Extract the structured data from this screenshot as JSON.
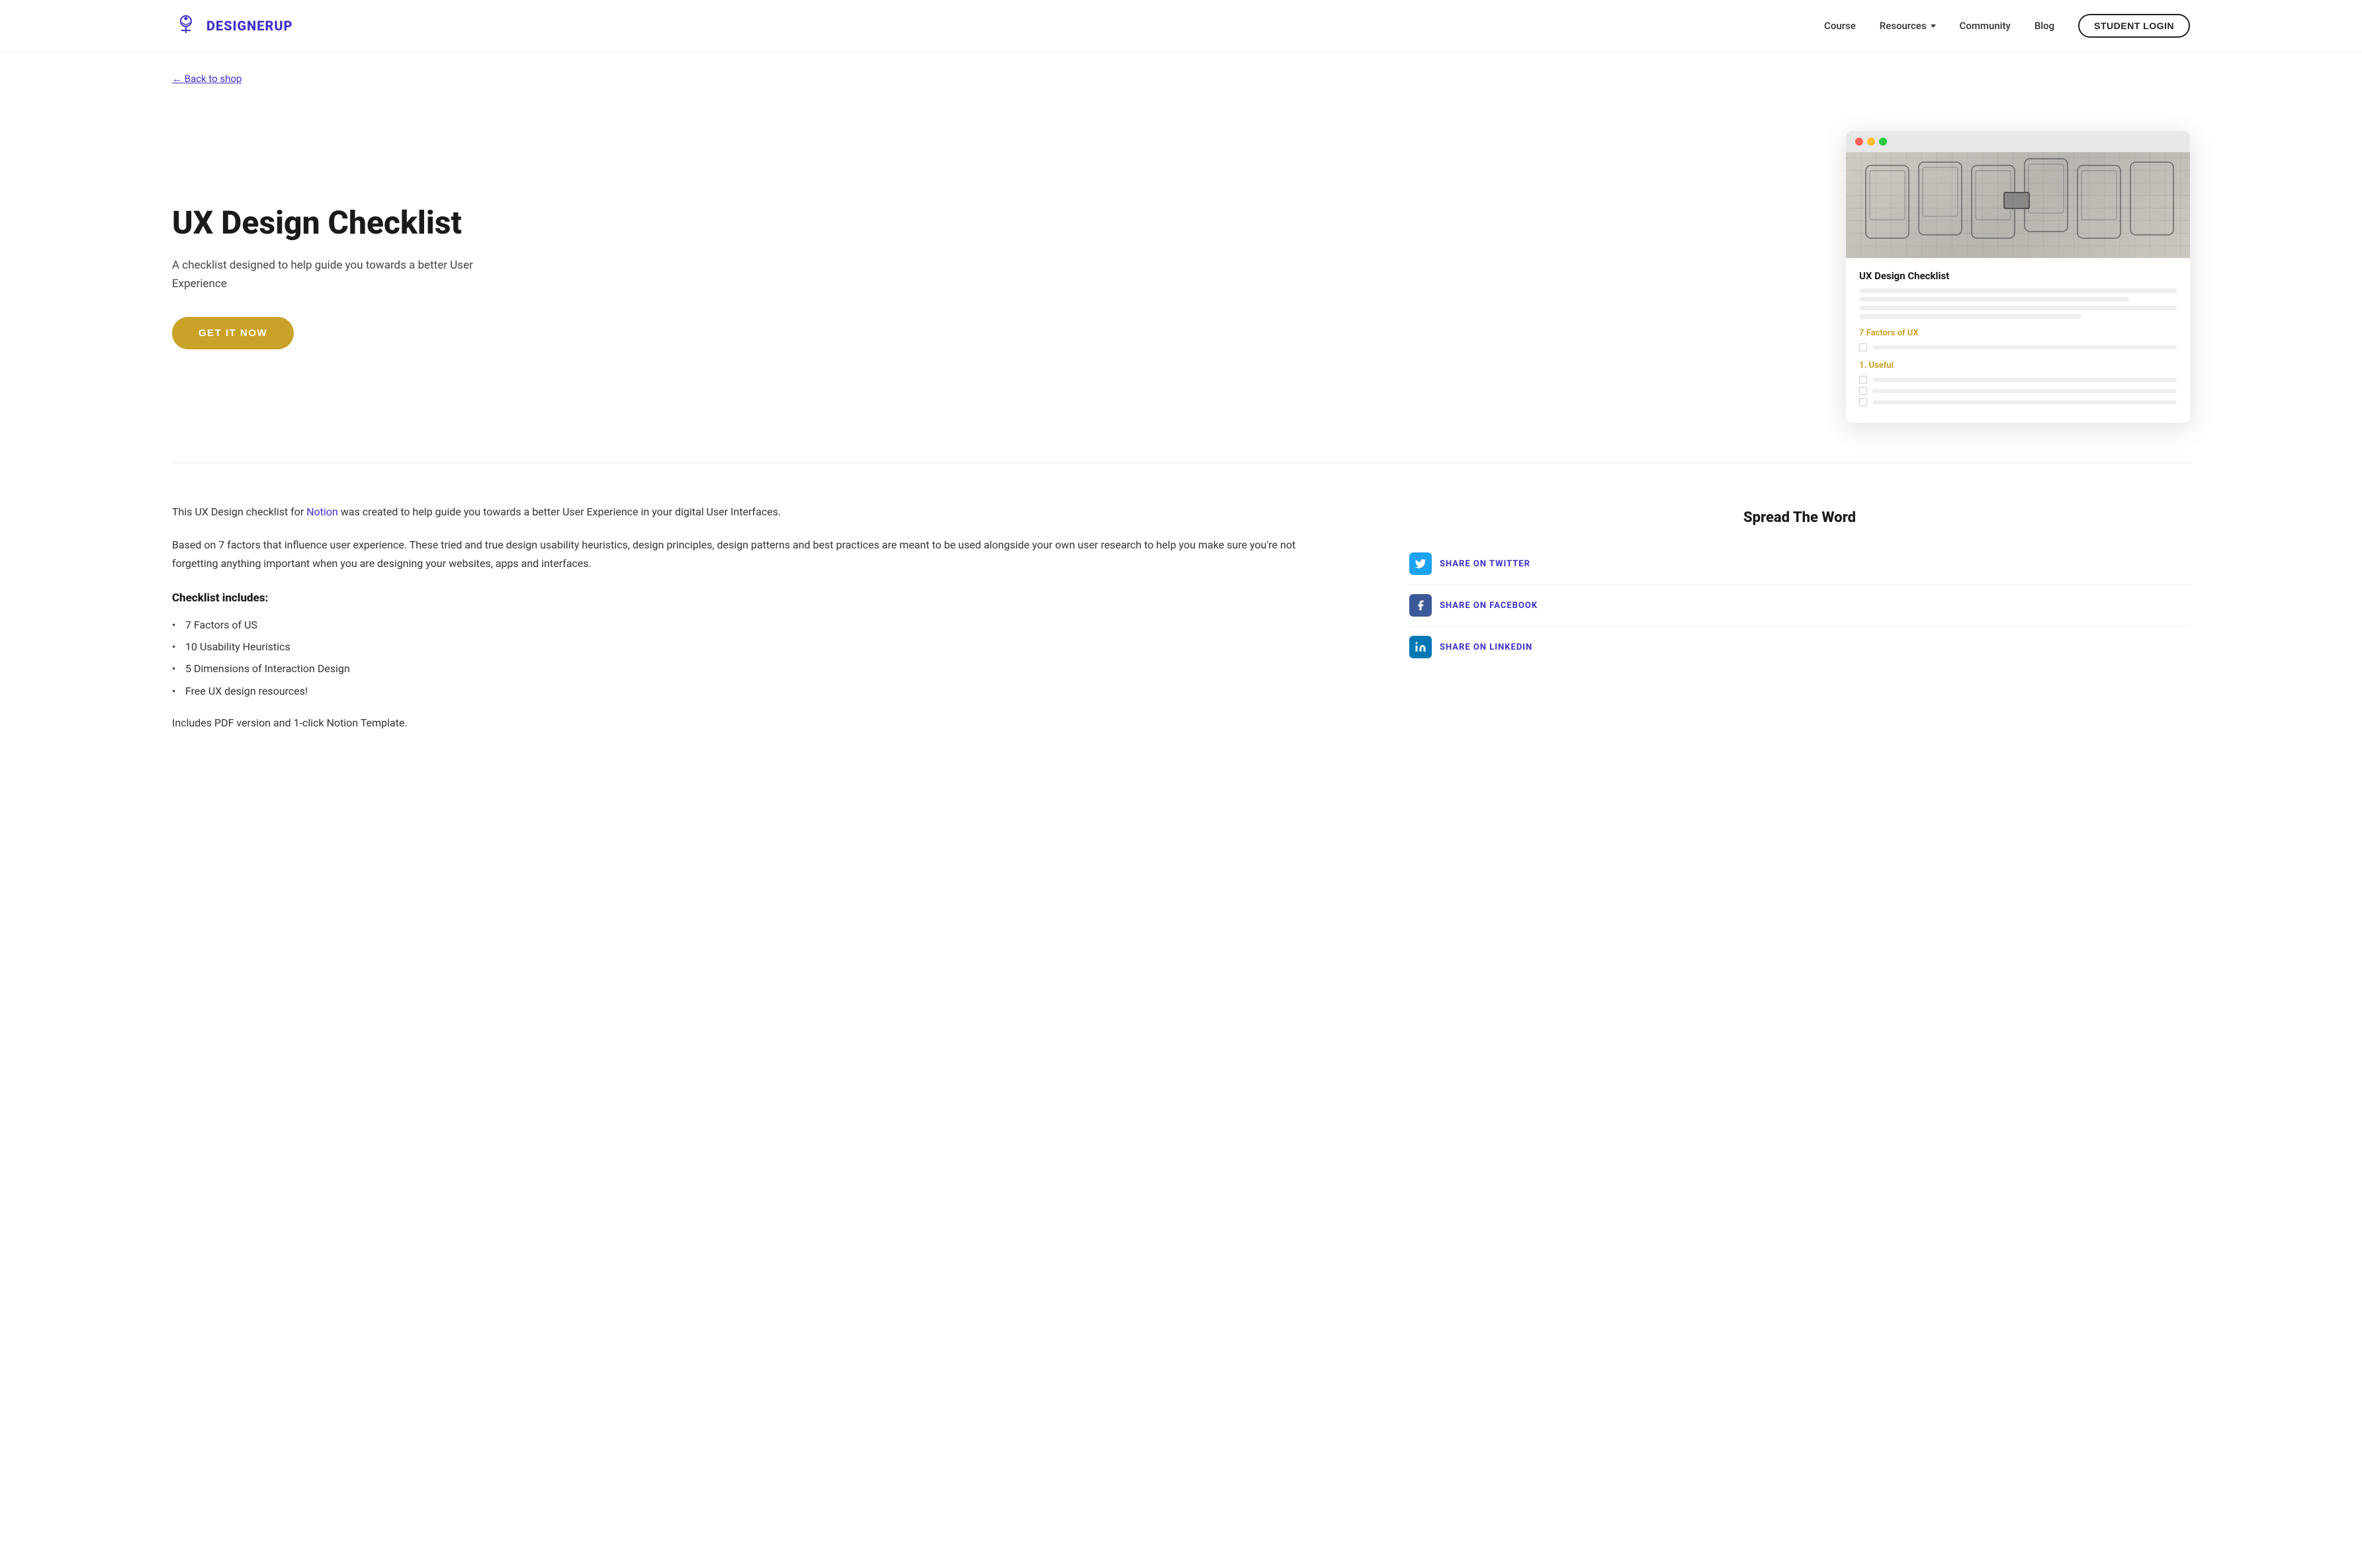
{
  "nav": {
    "logo_text": "DESIGNERUP",
    "links": [
      {
        "label": "Course",
        "id": "course"
      },
      {
        "label": "Resources",
        "id": "resources",
        "has_dropdown": true
      },
      {
        "label": "Community",
        "id": "community"
      },
      {
        "label": "Blog",
        "id": "blog"
      }
    ],
    "cta_label": "STUDENT LOGIN"
  },
  "back_link": {
    "arrow": "←",
    "label": "Back to shop"
  },
  "hero": {
    "title": "UX Design Checklist",
    "subtitle": "A checklist designed to help guide you towards a better User Experience",
    "cta_label": "GET IT NOW"
  },
  "browser_doc": {
    "title": "UX Design Checklist",
    "section_label": "7 Factors of UX",
    "subsection": "1. Useful"
  },
  "content": {
    "paragraph1_before_link": "This UX Design checklist for ",
    "notion_link": "Notion",
    "paragraph1_after_link": " was created to help guide you towards a better User Experience in your digital User Interfaces.",
    "paragraph2": "Based on 7 factors that influence user experience. These tried and true design usability heuristics, design principles, design patterns and best practices are meant to be used alongside your own user research to help you make sure you're not forgetting anything important when you are designing your websites, apps and interfaces.",
    "checklist_heading": "Checklist includes:",
    "checklist_items": [
      "7 Factors of US",
      "10 Usability Heuristics",
      "5 Dimensions of Interaction Design",
      "Free UX design resources!"
    ],
    "includes_para": "Includes PDF version and 1-click Notion Template."
  },
  "spread": {
    "title": "Spread The Word",
    "buttons": [
      {
        "label": "SHARE ON TWITTER",
        "icon": "twitter",
        "id": "twitter"
      },
      {
        "label": "SHARE ON FACEBOOK",
        "icon": "facebook",
        "id": "facebook"
      },
      {
        "label": "SHARE ON LINKEDIN",
        "icon": "linkedin",
        "id": "linkedin"
      }
    ]
  }
}
